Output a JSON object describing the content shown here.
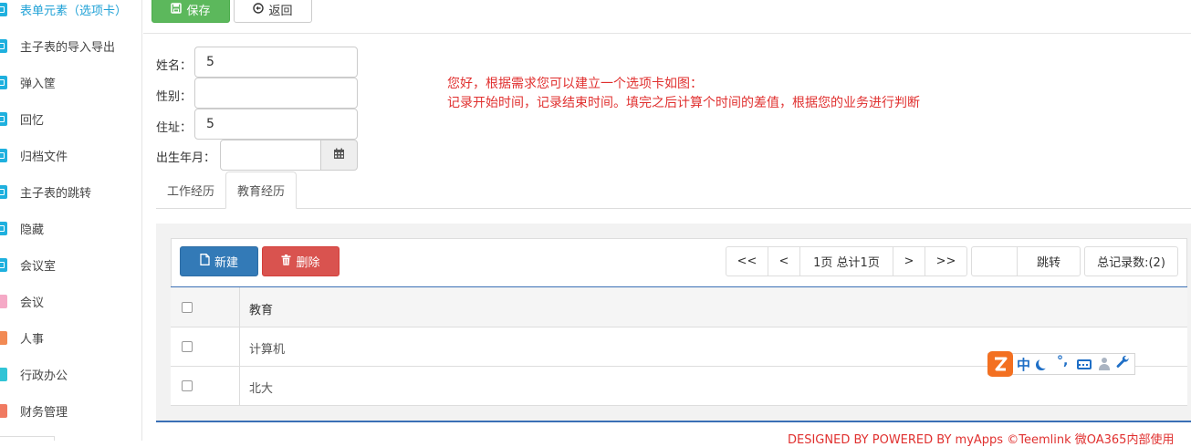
{
  "sidebar": {
    "items": [
      {
        "label": "表单元素（选项卡）",
        "icon": "cube-icon"
      },
      {
        "label": "主子表的导入导出",
        "icon": "cube-icon"
      },
      {
        "label": "弹入筐",
        "icon": "cube-icon"
      },
      {
        "label": "回忆",
        "icon": "cube-icon"
      },
      {
        "label": "归档文件",
        "icon": "cube-icon"
      },
      {
        "label": "主子表的跳转",
        "icon": "cube-icon"
      },
      {
        "label": "隐藏",
        "icon": "cube-icon"
      },
      {
        "label": "会议室",
        "icon": "cube-icon"
      },
      {
        "label": "会议",
        "icon": "meeting-icon"
      },
      {
        "label": "人事",
        "icon": "hr-icon"
      },
      {
        "label": "行政办公",
        "icon": "office-icon"
      },
      {
        "label": "财务管理",
        "icon": "finance-icon"
      }
    ],
    "active_index": 0
  },
  "toolbar": {
    "save_label": "保存",
    "back_label": "返回"
  },
  "form": {
    "name_label": "姓名：",
    "name_value": "5",
    "gender_label": "性别：",
    "gender_value": "",
    "address_label": "住址：",
    "address_value": "5",
    "birth_label": "出生年月：",
    "birth_value": ""
  },
  "note": {
    "line1": "您好，根据需求您可以建立一个选项卡如图：",
    "line2": "记录开始时间，记录结束时间。填完之后计算个时间的差值，根据您的业务进行判断"
  },
  "tabs": [
    {
      "label": "工作经历"
    },
    {
      "label": "教育经历"
    }
  ],
  "active_tab": 1,
  "grid": {
    "new_label": "新建",
    "delete_label": "删除",
    "pager": {
      "first": "<<",
      "prev": "<",
      "info": "1页 总计1页",
      "next": ">",
      "last": ">>",
      "jump_value": "",
      "jump_label": "跳转",
      "total": "总记录数:(2)"
    },
    "column_header": "教育",
    "rows": [
      {
        "value": "计算机"
      },
      {
        "value": "北大"
      }
    ]
  },
  "ime": {
    "mode": "中",
    "punct": "°,"
  },
  "footer": "DESIGNED BY POWERED BY myApps ©Teemlink 微OA365内部使用",
  "colors": {
    "save": "#5cb85c",
    "new": "#337ab7",
    "delete": "#d9534f",
    "note": "#e0302f",
    "active_sidebar": "#1fa1d6",
    "ime_logo": "#f37021"
  }
}
